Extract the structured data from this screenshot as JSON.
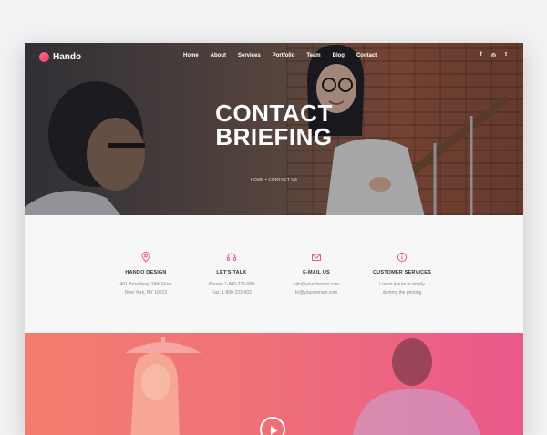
{
  "brand": {
    "name": "Hando",
    "accent": "#e8408a"
  },
  "nav": {
    "items": [
      "Home",
      "About",
      "Services",
      "Portfolio",
      "Team",
      "Blog",
      "Contact"
    ]
  },
  "social": [
    "f",
    "◎",
    "t"
  ],
  "hero": {
    "title_line1": "CONTACT",
    "title_line2": "BRIEFING",
    "breadcrumb": "HOME  •  CONTACT US"
  },
  "info": [
    {
      "icon": "location-pin-icon",
      "title": "HANDO DESIGN",
      "line1": "401 Broadway, 24th Floor",
      "line2": "New York, NY 10013"
    },
    {
      "icon": "headset-icon",
      "title": "LET'S TALK",
      "line1": "Phone: 1-800-222-000",
      "line2": "Fax: 1-800-222-002"
    },
    {
      "icon": "envelope-icon",
      "title": "E-MAIL US",
      "line1": "info@yourdomain.com",
      "line2": "hr@yourdomain.com"
    },
    {
      "icon": "info-icon",
      "title": "CUSTOMER SERVICES",
      "line1": "Lorem ipsum is simply",
      "line2": "dummy the printing"
    }
  ]
}
